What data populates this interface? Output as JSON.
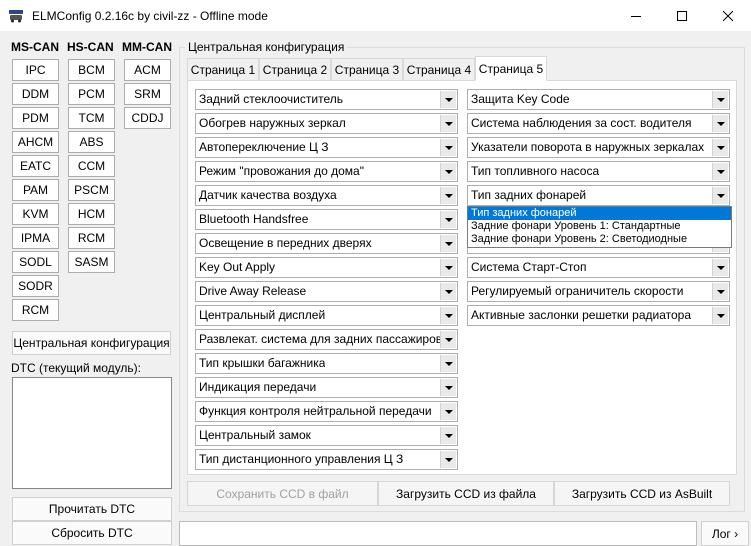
{
  "window": {
    "title": "ELMConfig 0.2.16c by civil-zz - Offline mode",
    "icon_name": "elm-car-icon",
    "controls": [
      "minimize-icon",
      "maximize-icon",
      "close-icon"
    ]
  },
  "modules": {
    "ms_can": {
      "header": "MS-CAN",
      "items": [
        "IPC",
        "DDM",
        "PDM",
        "AHCM",
        "EATC",
        "PAM",
        "KVM",
        "IPMA",
        "SODL",
        "SODR",
        "RCM"
      ]
    },
    "hs_can": {
      "header": "HS-CAN",
      "items": [
        "BCM",
        "PCM",
        "TCM",
        "ABS",
        "CCM",
        "PSCM",
        "HCM",
        "RCM",
        "SASM"
      ]
    },
    "mm_can": {
      "header": "MM-CAN",
      "items": [
        "ACM",
        "SRM",
        "CDDJ"
      ]
    }
  },
  "central_config_button": "Центральная конфигурация",
  "dtc": {
    "label": "DTC (текущий модуль):",
    "read_button": "Прочитать DTC",
    "reset_button": "Сбросить DTC"
  },
  "config": {
    "group_title": "Центральная конфигурация",
    "tabs": [
      "Страница 1",
      "Страница 2",
      "Страница 3",
      "Страница 4",
      "Страница 5"
    ],
    "active_tab": "Страница 5",
    "left_combos": [
      "Задний стеклоочиститель",
      "Обогрев наружных зеркал",
      "Автопереключение Ц З",
      "Режим \"провожания до дома\"",
      "Датчик качества воздуха",
      "Bluetooth Handsfree",
      "Освещение в передних дверях",
      "Key Out Apply",
      "Drive Away Release",
      "Центральный дисплей",
      "Развлекат. система для задних пассажиров",
      "Тип крышки багажника",
      "Индикация передачи",
      "Функция контроля нейтральной передачи",
      "Центральный замок",
      "Тип дистанционного управления Ц З"
    ],
    "right_combos": [
      "Защита Key Code",
      "Система наблюдения за сост. водителя",
      "Указатели поворота в наружных зеркалах",
      "Тип топливного насоса",
      "Тип задних фонарей",
      "",
      "",
      "Система Старт-Стоп",
      "Регулируемый ограничитель скорости",
      "Активные заслонки решетки радиатора"
    ],
    "dropdown": {
      "options": [
        "Тип задних фонарей",
        "Задние фонари Уровень 1: Стандартные",
        "Задние фонари Уровень 2: Светодиодные"
      ],
      "selected": "Тип задних фонарей"
    }
  },
  "bottom_buttons": {
    "save": "Сохранить CCD в файл",
    "load_file": "Загрузить CCD из файла",
    "load_asbuilt": "Загрузить CCD из AsBuilt"
  },
  "log_button": "Лог ›",
  "colors": {
    "selection": "#0078d7",
    "disabled_text": "#a0a0a0"
  }
}
